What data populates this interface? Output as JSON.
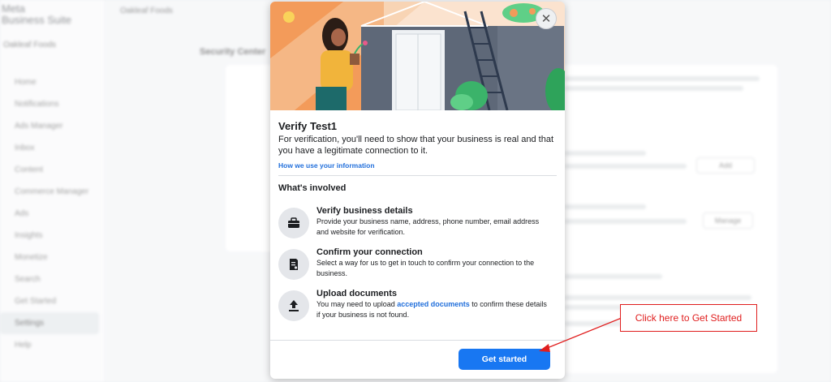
{
  "background": {
    "app_title_line1": "Meta",
    "app_title_line2": "Business Suite",
    "account_name": "Oakleaf Foods",
    "nav_items": [
      "Home",
      "Notifications",
      "Ads Manager",
      "Inbox",
      "Content",
      "Commerce Manager",
      "Ads",
      "Insights",
      "Monetize",
      "Search",
      "Get Started",
      "Settings",
      "Help"
    ],
    "page_heading": "Security Center",
    "add_button": "Add",
    "manage_button": "Manage"
  },
  "modal": {
    "close_icon": "close-icon",
    "title": "Verify Test1",
    "description": "For verification, you'll need to show that your business is real and that you have a legitimate connection to it.",
    "info_link": "How we use your information",
    "section_title": "What's involved",
    "steps": [
      {
        "icon": "briefcase-icon",
        "title": "Verify business details",
        "description": "Provide your business name, address, phone number, email address and website for verification."
      },
      {
        "icon": "document-icon",
        "title": "Confirm your connection",
        "description": "Select a way for us to get in touch to confirm your connection to the business."
      },
      {
        "icon": "upload-icon",
        "title": "Upload documents",
        "description_before": "You may need to upload ",
        "description_link": "accepted documents",
        "description_after": " to confirm these details if your business is not found."
      }
    ],
    "cta_label": "Get started"
  },
  "annotation": {
    "callout_text": "Click here to Get Started",
    "color": "#e01e1e"
  },
  "colors": {
    "primary": "#1877f2",
    "link": "#216fdb"
  }
}
